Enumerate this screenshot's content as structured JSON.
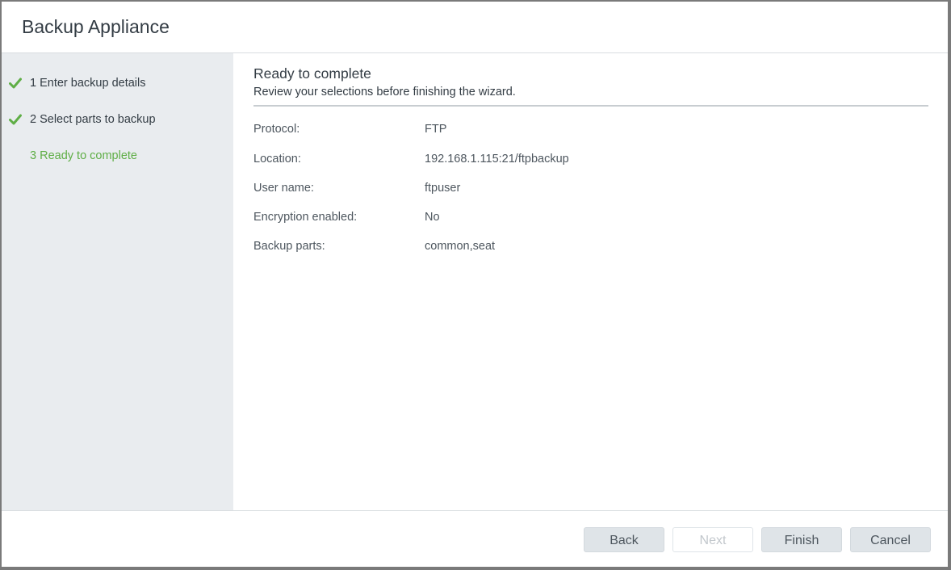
{
  "dialog": {
    "title": "Backup Appliance"
  },
  "steps": [
    {
      "label": "1 Enter backup details",
      "status": "completed",
      "icon": "check-icon"
    },
    {
      "label": "2 Select parts to backup",
      "status": "completed",
      "icon": "check-icon"
    },
    {
      "label": "3 Ready to complete",
      "status": "active"
    }
  ],
  "page": {
    "title": "Ready to complete",
    "subtitle": "Review your selections before finishing the wizard."
  },
  "summary": [
    {
      "key": "Protocol:",
      "value": "FTP"
    },
    {
      "key": "Location:",
      "value": "192.168.1.115:21/ftpbackup"
    },
    {
      "key": "User name:",
      "value": "ftpuser"
    },
    {
      "key": "Encryption enabled:",
      "value": "No"
    },
    {
      "key": "Backup parts:",
      "value": "common,seat"
    }
  ],
  "buttons": {
    "back": "Back",
    "next": "Next",
    "finish": "Finish",
    "cancel": "Cancel"
  },
  "colors": {
    "accent_green": "#5fae46",
    "sidebar_bg": "#e9ecef",
    "button_bg": "#dfe4e8"
  }
}
